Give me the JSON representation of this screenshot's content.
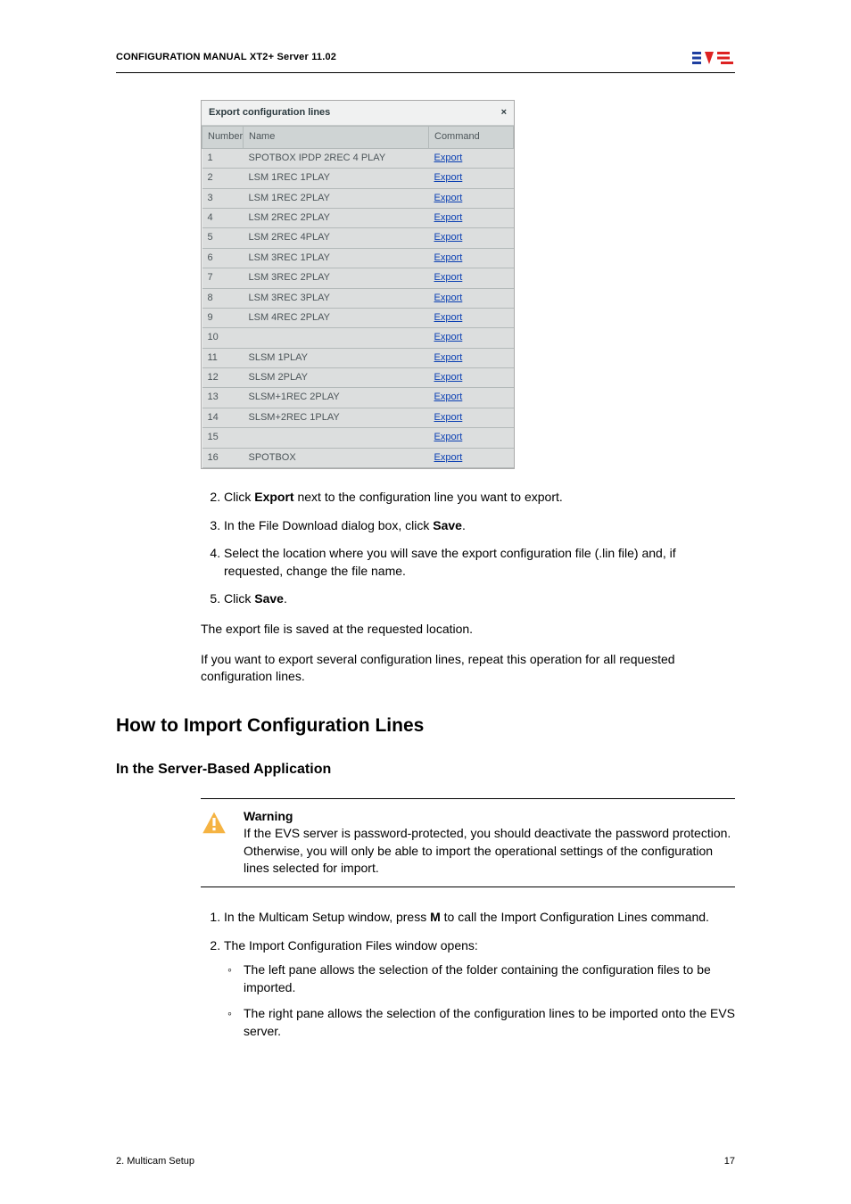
{
  "header": {
    "title": "CONFIGURATION MANUAL  XT2+ Server 11.02"
  },
  "dialog": {
    "title": "Export configuration lines",
    "close_glyph": "×",
    "columns": {
      "number": "Number",
      "name": "Name",
      "command": "Command"
    },
    "command_label": "Export",
    "rows": [
      {
        "number": "1",
        "name": "SPOTBOX IPDP 2REC 4 PLAY"
      },
      {
        "number": "2",
        "name": "LSM 1REC 1PLAY"
      },
      {
        "number": "3",
        "name": "LSM 1REC 2PLAY"
      },
      {
        "number": "4",
        "name": "LSM 2REC 2PLAY"
      },
      {
        "number": "5",
        "name": "LSM 2REC 4PLAY"
      },
      {
        "number": "6",
        "name": "LSM 3REC 1PLAY"
      },
      {
        "number": "7",
        "name": "LSM 3REC 2PLAY"
      },
      {
        "number": "8",
        "name": "LSM 3REC 3PLAY"
      },
      {
        "number": "9",
        "name": "LSM 4REC 2PLAY"
      },
      {
        "number": "10",
        "name": ""
      },
      {
        "number": "11",
        "name": "SLSM 1PLAY"
      },
      {
        "number": "12",
        "name": "SLSM 2PLAY"
      },
      {
        "number": "13",
        "name": "SLSM+1REC 2PLAY"
      },
      {
        "number": "14",
        "name": "SLSM+2REC 1PLAY"
      },
      {
        "number": "15",
        "name": ""
      },
      {
        "number": "16",
        "name": "SPOTBOX"
      }
    ]
  },
  "steps_a": {
    "s2_pre": "Click ",
    "s2_bold": "Export",
    "s2_post": " next to the configuration line you want to export.",
    "s3_pre": "In the File Download dialog box, click ",
    "s3_bold": "Save",
    "s3_post": ".",
    "s4": "Select the location where you will save the export configuration file (.lin file) and, if requested, change the file name.",
    "s5_pre": "Click ",
    "s5_bold": "Save",
    "s5_post": "."
  },
  "paras": {
    "p1": "The export file is saved at the requested location.",
    "p2": "If you want to export several configuration lines, repeat this operation for all requested configuration lines."
  },
  "h2": "How to Import Configuration Lines",
  "h3": "In the Server-Based Application",
  "warning": {
    "label": "Warning",
    "body": "If the EVS server is password-protected, you should deactivate the password protection. Otherwise, you will only be able to import the operational settings of the configuration lines selected for import."
  },
  "steps_b": {
    "s1_pre": "In the Multicam Setup window, press ",
    "s1_bold": "M",
    "s1_post": " to call the Import Configuration Lines command.",
    "s2": "The Import Configuration Files window opens:",
    "s2_b1": "The left pane allows the selection of the folder containing the configuration files to be imported.",
    "s2_b2": "The right pane allows the selection of the configuration lines to be imported onto the EVS server."
  },
  "footer": {
    "left": "2. Multicam Setup",
    "right": "17"
  }
}
